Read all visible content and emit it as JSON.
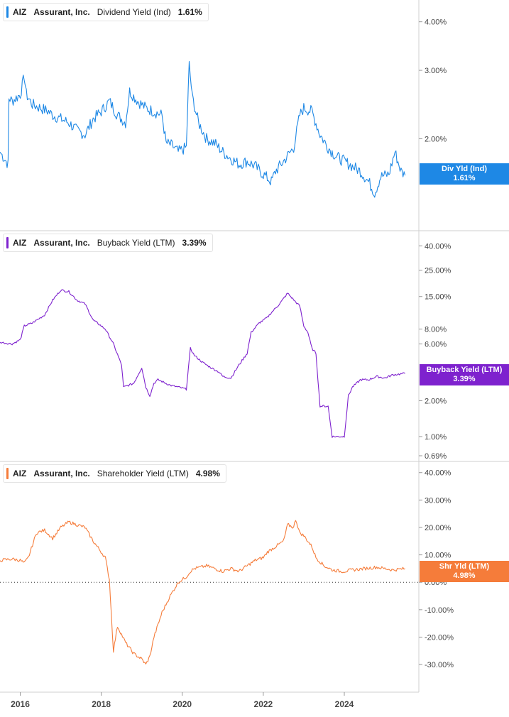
{
  "chart_data": [
    {
      "type": "line",
      "ticker": "AIZ",
      "company": "Assurant, Inc.",
      "metric": "Dividend Yield (Ind)",
      "current_value": "1.61%",
      "badge": {
        "label": "Div Yld (Ind)",
        "value": "1.61%"
      },
      "color": "#1e88e5",
      "scale": "log",
      "ylim": [
        1.2,
        4.4
      ],
      "yticks": [
        {
          "v": 4,
          "label": "4.00%"
        },
        {
          "v": 3,
          "label": "3.00%"
        },
        {
          "v": 2,
          "label": "2.00%"
        }
      ],
      "series": [
        {
          "x": [
            2015.5,
            2015.7,
            2015.72,
            2015.8,
            2016.0,
            2016.1,
            2016.15,
            2016.3,
            2016.5,
            2016.7,
            2016.8,
            2017.0,
            2017.2,
            2017.4,
            2017.6,
            2017.8,
            2018.0,
            2018.2,
            2018.4,
            2018.6,
            2018.7,
            2018.9,
            2019.1,
            2019.3,
            2019.5,
            2019.6,
            2019.75,
            2019.9,
            2020.1,
            2020.17,
            2020.25,
            2020.4,
            2020.6,
            2020.8,
            2021.0,
            2021.2,
            2021.4,
            2021.6,
            2021.8,
            2022.0,
            2022.2,
            2022.3,
            2022.5,
            2022.75,
            2022.9,
            2023.0,
            2023.2,
            2023.4,
            2023.6,
            2023.8,
            2024.0,
            2024.2,
            2024.4,
            2024.6,
            2024.75,
            2024.9,
            2025.1,
            2025.25,
            2025.4,
            2025.5
          ],
          "values": [
            1.85,
            1.72,
            2.55,
            2.5,
            2.6,
            2.9,
            2.6,
            2.45,
            2.4,
            2.35,
            2.3,
            2.25,
            2.2,
            2.1,
            2.05,
            2.25,
            2.35,
            2.5,
            2.3,
            2.2,
            2.65,
            2.5,
            2.4,
            2.35,
            2.3,
            1.95,
            1.92,
            1.85,
            1.9,
            3.1,
            2.55,
            2.2,
            2.0,
            1.95,
            1.85,
            1.78,
            1.72,
            1.75,
            1.7,
            1.62,
            1.55,
            1.65,
            1.75,
            1.9,
            2.3,
            2.4,
            2.35,
            2.05,
            1.9,
            1.8,
            1.75,
            1.7,
            1.65,
            1.55,
            1.45,
            1.6,
            1.62,
            1.85,
            1.65,
            1.61
          ]
        }
      ]
    },
    {
      "type": "line",
      "ticker": "AIZ",
      "company": "Assurant, Inc.",
      "metric": "Buyback Yield (LTM)",
      "current_value": "3.39%",
      "badge": {
        "label": "Buyback Yield (LTM)",
        "value": "3.39%"
      },
      "color": "#7e22ce",
      "scale": "log",
      "ylim": [
        0.69,
        48
      ],
      "yticks": [
        {
          "v": 40,
          "label": "40.00%"
        },
        {
          "v": 25,
          "label": "25.00%"
        },
        {
          "v": 15,
          "label": "15.00%"
        },
        {
          "v": 8,
          "label": "8.00%"
        },
        {
          "v": 6,
          "label": "6.00%"
        },
        {
          "v": 2,
          "label": "2.00%"
        },
        {
          "v": 1,
          "label": "1.00%"
        },
        {
          "v": 0.69,
          "label": "0.69%"
        }
      ],
      "series": [
        {
          "x": [
            2015.5,
            2015.8,
            2016.0,
            2016.1,
            2016.3,
            2016.6,
            2016.8,
            2017.0,
            2017.2,
            2017.4,
            2017.6,
            2017.8,
            2017.9,
            2018.1,
            2018.3,
            2018.5,
            2018.55,
            2018.8,
            2019.0,
            2019.1,
            2019.2,
            2019.3,
            2019.4,
            2019.5,
            2019.7,
            2019.9,
            2020.1,
            2020.2,
            2020.3,
            2020.5,
            2020.7,
            2020.9,
            2021.0,
            2021.2,
            2021.4,
            2021.6,
            2021.7,
            2021.9,
            2022.1,
            2022.2,
            2022.4,
            2022.6,
            2022.8,
            2022.9,
            2023.0,
            2023.1,
            2023.2,
            2023.3,
            2023.4,
            2023.6,
            2023.7,
            2023.9,
            2024.0,
            2024.1,
            2024.2,
            2024.4,
            2024.6,
            2024.8,
            2025.0,
            2025.2,
            2025.5
          ],
          "values": [
            6.2,
            6.0,
            6.5,
            8.5,
            9.0,
            10.5,
            14.0,
            17.0,
            16.5,
            14.0,
            13.0,
            9.5,
            9.0,
            8.0,
            6.0,
            4.0,
            2.6,
            2.8,
            3.8,
            2.6,
            2.2,
            2.8,
            3.0,
            2.9,
            2.7,
            2.6,
            2.5,
            5.5,
            4.8,
            4.2,
            3.8,
            3.5,
            3.2,
            3.1,
            4.0,
            5.0,
            7.5,
            9.0,
            10.0,
            11.0,
            13.0,
            16.0,
            13.5,
            12.5,
            8.5,
            7.5,
            5.5,
            5.0,
            1.8,
            1.8,
            1.0,
            1.0,
            1.0,
            2.2,
            2.6,
            3.0,
            3.0,
            3.2,
            3.1,
            3.3,
            3.39
          ]
        }
      ]
    },
    {
      "type": "line",
      "ticker": "AIZ",
      "company": "Assurant, Inc.",
      "metric": "Shareholder Yield (LTM)",
      "current_value": "4.98%",
      "badge": {
        "label": "Shr Yld (LTM)",
        "value": "4.98%"
      },
      "color": "#f57c3a",
      "scale": "linear",
      "ylim": [
        -38,
        42
      ],
      "zero_line": true,
      "yticks": [
        {
          "v": 40,
          "label": "40.00%"
        },
        {
          "v": 30,
          "label": "30.00%"
        },
        {
          "v": 20,
          "label": "20.00%"
        },
        {
          "v": 10,
          "label": "10.00%"
        },
        {
          "v": 0,
          "label": "0.00%"
        },
        {
          "v": -10,
          "label": "-10.00%"
        },
        {
          "v": -20,
          "label": "-20.00%"
        },
        {
          "v": -30,
          "label": "-30.00%"
        }
      ],
      "series": [
        {
          "x": [
            2015.5,
            2015.8,
            2016.0,
            2016.1,
            2016.2,
            2016.4,
            2016.6,
            2016.8,
            2017.0,
            2017.2,
            2017.4,
            2017.6,
            2017.8,
            2018.0,
            2018.1,
            2018.2,
            2018.3,
            2018.4,
            2018.6,
            2018.8,
            2019.0,
            2019.1,
            2019.2,
            2019.3,
            2019.5,
            2019.7,
            2019.9,
            2020.1,
            2020.2,
            2020.3,
            2020.6,
            2020.8,
            2021.0,
            2021.2,
            2021.4,
            2021.6,
            2021.8,
            2022.0,
            2022.1,
            2022.3,
            2022.5,
            2022.6,
            2022.75,
            2022.8,
            2022.9,
            2023.0,
            2023.2,
            2023.3,
            2023.5,
            2023.7,
            2023.9,
            2024.0,
            2024.2,
            2024.5,
            2024.8,
            2025.0,
            2025.2,
            2025.5
          ],
          "values": [
            8.0,
            8.5,
            8.0,
            7.0,
            9.0,
            18.0,
            19.0,
            16.0,
            20.0,
            22.0,
            21.0,
            20.0,
            15.0,
            11.0,
            9.0,
            1.0,
            -25.0,
            -16.0,
            -22.0,
            -26.0,
            -28.0,
            -30.0,
            -27.0,
            -20.0,
            -11.0,
            -5.0,
            0.0,
            2.0,
            4.0,
            5.0,
            6.0,
            5.0,
            4.0,
            5.0,
            4.0,
            6.0,
            8.0,
            9.0,
            11.0,
            13.0,
            15.0,
            21.0,
            20.0,
            23.0,
            18.0,
            17.0,
            13.0,
            9.0,
            6.0,
            4.5,
            4.0,
            4.0,
            4.5,
            5.0,
            5.5,
            5.0,
            4.5,
            4.98
          ]
        }
      ]
    }
  ],
  "x_axis": {
    "ticks": [
      {
        "x": 2016,
        "label": "2016"
      },
      {
        "x": 2018,
        "label": "2018"
      },
      {
        "x": 2020,
        "label": "2020"
      },
      {
        "x": 2022,
        "label": "2022"
      },
      {
        "x": 2024,
        "label": "2024"
      }
    ]
  }
}
